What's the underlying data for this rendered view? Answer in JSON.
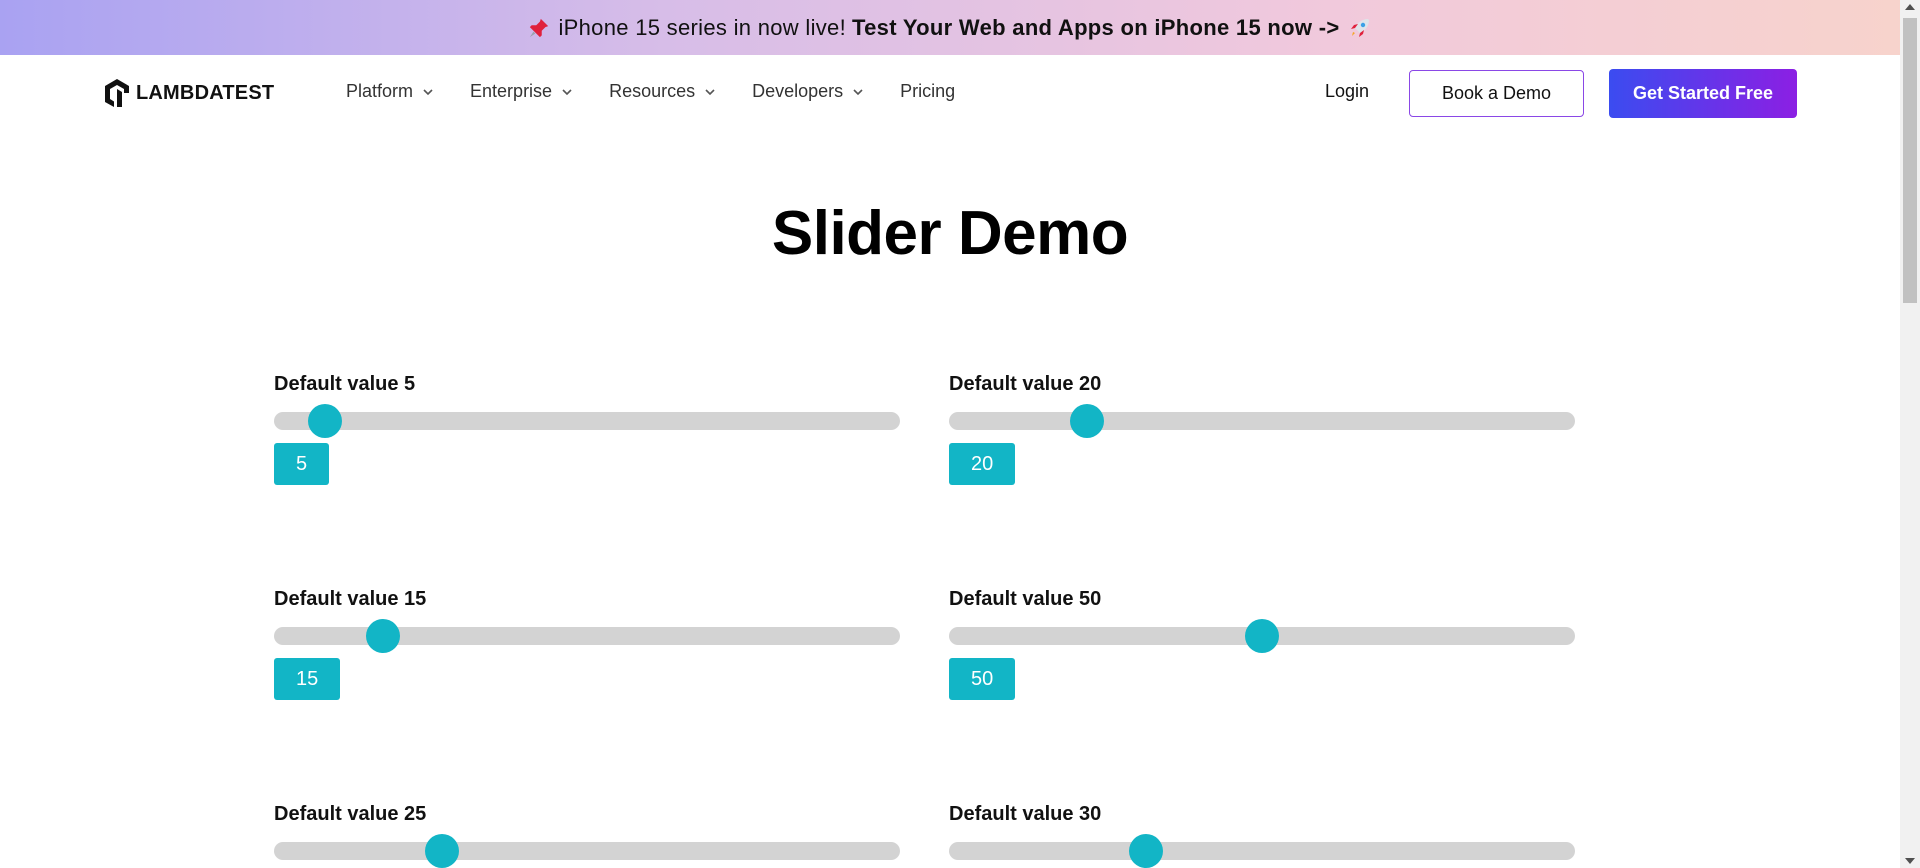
{
  "banner": {
    "text_prefix": "iPhone 15 series in now live!",
    "text_bold": "Test Your Web and Apps on iPhone 15 now ->",
    "left_icon": "pushpin-icon",
    "right_icon": "rocket-icon"
  },
  "nav": {
    "logo_text": "LAMBDATEST",
    "menu": [
      {
        "label": "Platform",
        "has_dropdown": true
      },
      {
        "label": "Enterprise",
        "has_dropdown": true
      },
      {
        "label": "Resources",
        "has_dropdown": true
      },
      {
        "label": "Developers",
        "has_dropdown": true
      },
      {
        "label": "Pricing",
        "has_dropdown": false
      }
    ],
    "login_label": "Login",
    "book_demo_label": "Book a Demo",
    "get_started_label": "Get Started Free"
  },
  "page": {
    "title": "Slider Demo"
  },
  "sliders": [
    {
      "label": "Default value 5",
      "value": "5",
      "min": 0,
      "max": 100
    },
    {
      "label": "Default value 20",
      "value": "20",
      "min": 0,
      "max": 100
    },
    {
      "label": "Default value 15",
      "value": "15",
      "min": 0,
      "max": 100
    },
    {
      "label": "Default value 50",
      "value": "50",
      "min": 0,
      "max": 100
    },
    {
      "label": "Default value 25",
      "value": "25",
      "min": 0,
      "max": 100
    },
    {
      "label": "Default value 30",
      "value": "30",
      "min": 0,
      "max": 100
    }
  ],
  "colors": {
    "accent": "#12b5c6",
    "track": "#d3d3d3",
    "cta_gradient_start": "#3b4cf0",
    "cta_gradient_end": "#8c1fe3"
  }
}
